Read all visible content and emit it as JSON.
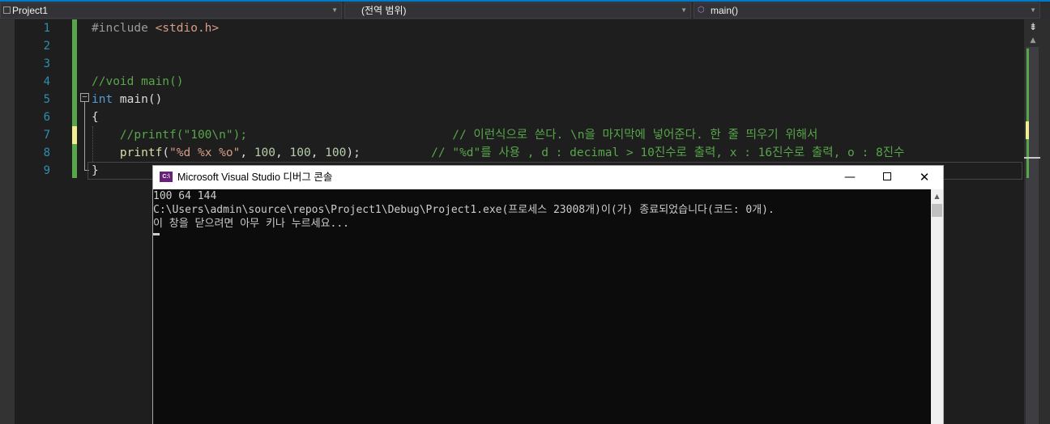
{
  "navbar": {
    "project": "Project1",
    "scope": "(전역 범위)",
    "function": "main()"
  },
  "editor": {
    "line_numbers": [
      "1",
      "2",
      "3",
      "4",
      "5",
      "6",
      "7",
      "8",
      "9"
    ],
    "lines": {
      "l1_directive": "#include",
      "l1_header": "<stdio.h>",
      "l4_comment": "//void main()",
      "l5_keyword": "int",
      "l5_rest": " main()",
      "l6_brace": "{",
      "l7_code_comment": "//printf(\"100\\n\");",
      "l7_comment": "// 이런식으로 쓴다. \\n을 마지막에 넣어준다. 한 줄 띄우기 위해서",
      "l8_fn": "printf",
      "l8_open": "(",
      "l8_string": "\"%d %x %o\"",
      "l8_comma1": ", ",
      "l8_n1": "100",
      "l8_comma2": ", ",
      "l8_n2": "100",
      "l8_comma3": ", ",
      "l8_n3": "100",
      "l8_close": ");",
      "l8_comment": "// \"%d\"를 사용 , d : decimal > 10진수로 출력, x : 16진수로 출력, o : 8진수",
      "l9_brace": "}"
    }
  },
  "console": {
    "title": "Microsoft Visual Studio 디버그 콘솔",
    "icon_label": "C:\\",
    "output": [
      "100 64 144",
      "C:\\Users\\admin\\source\\repos\\Project1\\Debug\\Project1.exe(프로세스 23008개)이(가) 종료되었습니다(코드: 0개).",
      "이 창을 닫으려면 아무 키나 누르세요..."
    ],
    "buttons": {
      "minimize": "—",
      "close": "✕"
    }
  },
  "icons": {
    "project": "project-icon",
    "function": "function-cube-icon",
    "dropdown": "chevron-down-icon",
    "split": "split-window-icon",
    "app": "visual-studio-console-icon"
  },
  "colors": {
    "accent": "#007acc",
    "keyword": "#569cd6",
    "comment": "#57a64a",
    "string": "#d69d85",
    "line_number": "#2b91af"
  }
}
